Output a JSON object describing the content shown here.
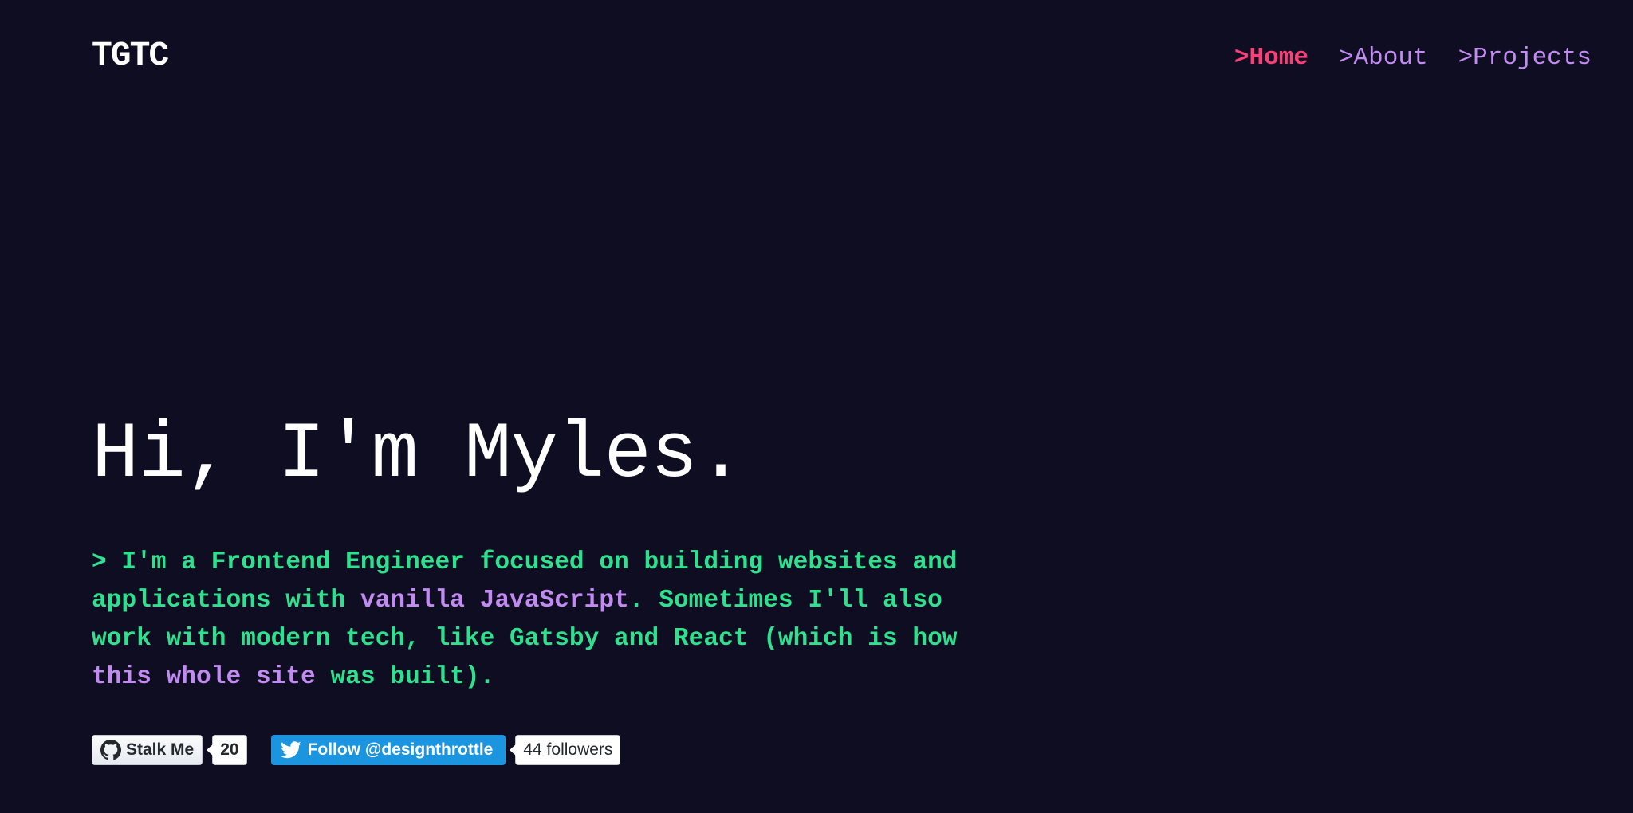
{
  "site": {
    "logo": "TGTC"
  },
  "nav": {
    "items": [
      {
        "label": ">Home",
        "active": true
      },
      {
        "label": ">About",
        "active": false
      },
      {
        "label": ">Projects",
        "active": false
      }
    ]
  },
  "hero": {
    "title": "Hi, I'm Myles.",
    "intro": {
      "part1": "> I'm a Frontend Engineer focused on building websites and applications with ",
      "highlight1": "vanilla JavaScript",
      "part2": ". Sometimes I'll also work with modern tech, like Gatsby and React (which is how ",
      "highlight2": "this whole site",
      "part3": " was built)."
    }
  },
  "badges": {
    "github": {
      "label": "Stalk Me",
      "count": "20",
      "icon": "github-icon"
    },
    "twitter": {
      "label": "Follow @designthrottle",
      "count": "44 followers",
      "icon": "twitter-bird-icon"
    }
  },
  "colors": {
    "background": "#0f0d21",
    "accent_pink": "#fc3f78",
    "accent_purple": "#c28bf2",
    "accent_green": "#2fe18e",
    "twitter_blue": "#1b95e0"
  }
}
